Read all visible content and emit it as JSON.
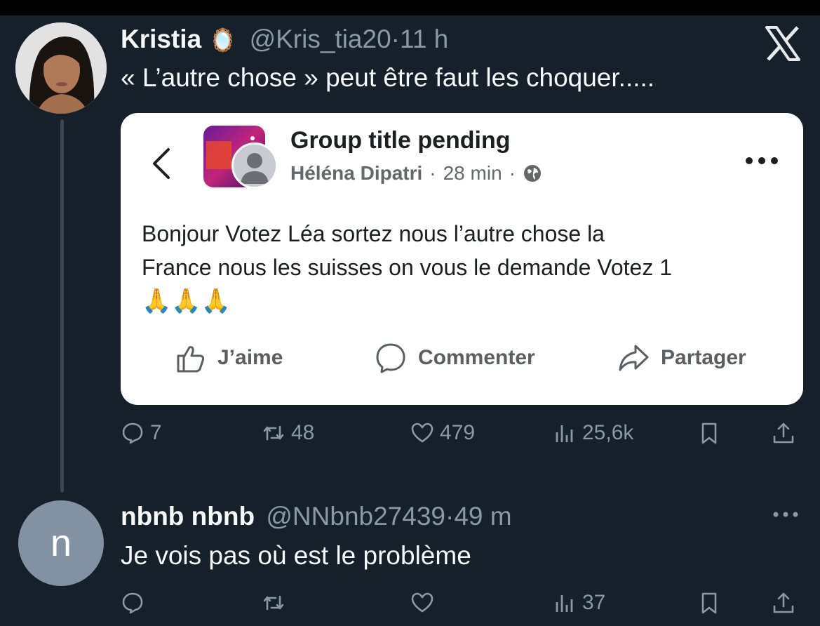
{
  "tweet": {
    "author_name": "Kristia",
    "author_badge": "🪞",
    "handle": "@Kris_tia20",
    "separator": "·",
    "time": "11 h",
    "text": "« L’autre chose » peut être faut les choquer.....",
    "embedded_post": {
      "group_title": "Group title pending",
      "author": "Héléna Dipatri",
      "separator": "·",
      "time": "28 min",
      "separator2": "·",
      "body_line1": "Bonjour Votez Léa sortez nous l’autre chose la",
      "body_line2": "France nous les suisses on vous le demande Votez 1",
      "body_emoji": "🙏🙏🙏",
      "actions": {
        "like": "J’aime",
        "comment": "Commenter",
        "share": "Partager"
      }
    },
    "stats": {
      "replies": "7",
      "retweets": "48",
      "likes": "479",
      "views": "25,6k"
    }
  },
  "reply": {
    "avatar_letter": "n",
    "author_name": "nbnb nbnb",
    "handle": "@NNbnb27439",
    "separator": "·",
    "time": "49 m",
    "text": "Je vois pas où est le problème",
    "stats": {
      "views": "37"
    }
  },
  "colors": {
    "background": "#15202b",
    "muted": "#8b98a5",
    "text": "#f7f9f9",
    "card": "#ffffff"
  }
}
